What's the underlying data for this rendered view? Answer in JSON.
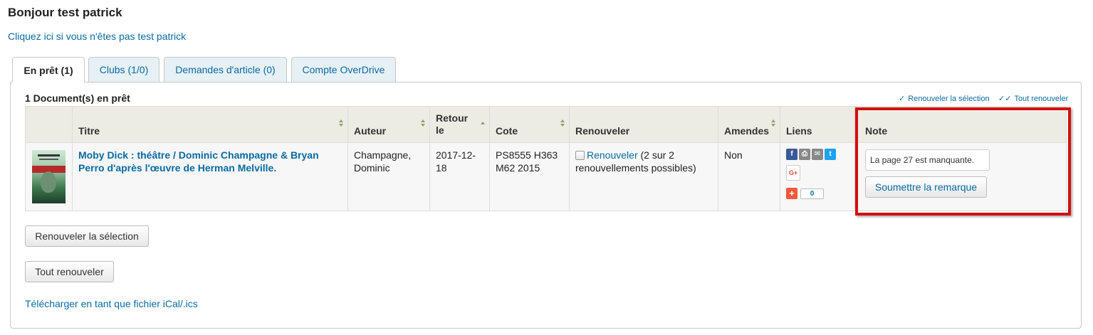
{
  "header": {
    "greeting": "Bonjour test patrick",
    "not_me_link": "Cliquez ici si vous n'êtes pas test patrick"
  },
  "tabs": [
    {
      "label": "En prêt (1)",
      "active": true
    },
    {
      "label": "Clubs (1/0)",
      "active": false
    },
    {
      "label": "Demandes d'article (0)",
      "active": false
    },
    {
      "label": "Compte OverDrive",
      "active": false
    }
  ],
  "panel": {
    "title": "1 Document(s) en prêt",
    "renew_selected_link": "Renouveler la sélection",
    "renew_all_link": "Tout renouveler"
  },
  "table": {
    "headers": {
      "title": "Titre",
      "author": "Auteur",
      "due": "Retour le",
      "call_number": "Cote",
      "renew": "Renouveler",
      "fines": "Amendes",
      "links": "Liens",
      "note": "Note"
    },
    "rows": [
      {
        "title": "Moby Dick : théâtre / Dominic Champagne & Bryan Perro d'après l'œuvre de Herman Melville.",
        "author": "Champagne, Dominic",
        "due": "2017-12-18",
        "call_number": "PS8555 H363 M62 2015",
        "renew_link": "Renouveler",
        "renew_info": "(2 sur 2 renouvellements possibles)",
        "fines": "Non",
        "share_count": "0",
        "note_value": "La page 27 est manquante.",
        "submit_note": "Soumettre la remarque"
      }
    ]
  },
  "buttons": {
    "renew_selected": "Renouveler la sélection",
    "renew_all": "Tout renouveler"
  },
  "ical_link": "Télécharger en tant que fichier iCal/.ics",
  "icons": {
    "facebook": "facebook-icon",
    "print": "print-icon",
    "email": "email-icon",
    "twitter": "twitter-icon",
    "google_plus": "google-plus-icon",
    "addthis": "addthis-plus-icon"
  },
  "colors": {
    "link": "#0a6aa1",
    "highlight_border": "#d30f0f",
    "header_bg": "#ecece4"
  }
}
